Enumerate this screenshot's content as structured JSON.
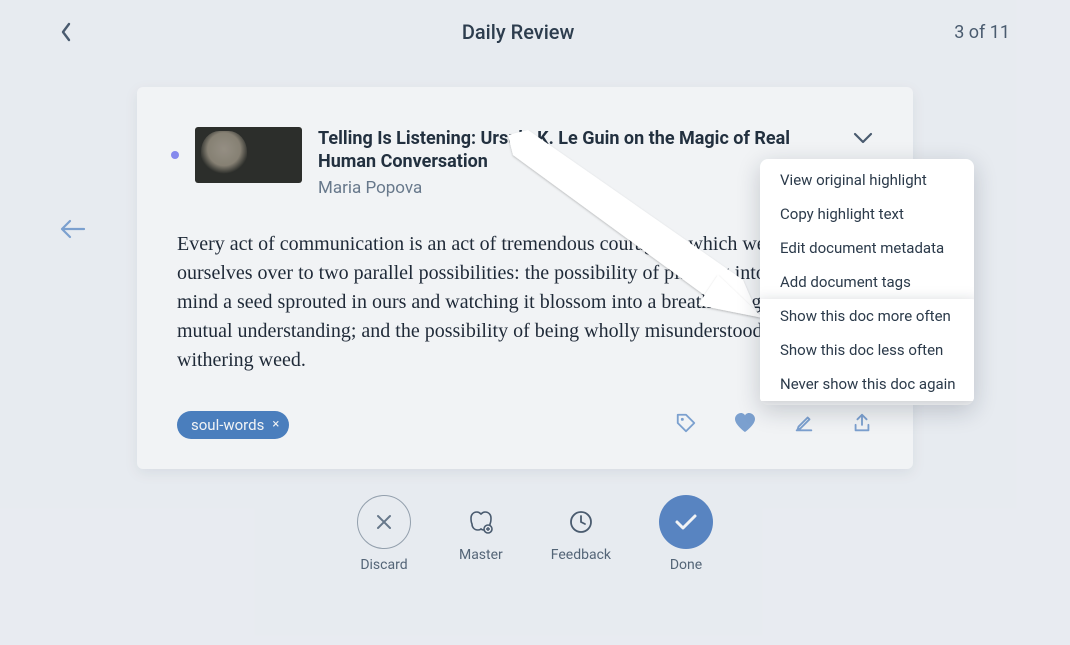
{
  "header": {
    "title": "Daily Review",
    "counter": "3 of 11"
  },
  "card": {
    "title": "Telling Is Listening: Ursula K. Le Guin on the Magic of Real Human Conversation",
    "author": "Maria Popova",
    "body": "Every act of communication is an act of tremendous courage in which we give ourselves over to two parallel possibilities: the possibility of planting into another mind a seed sprouted in ours and watching it blossom into a breathtaking flower of mutual understanding; and the possibility of being wholly misunderstood, reduced to a withering weed.",
    "tag": {
      "label": "soul-words",
      "remove": "×"
    }
  },
  "dropdown": {
    "items": [
      "View original highlight",
      "Copy highlight text",
      "Edit document metadata",
      "Add document tags",
      "Show this doc more often",
      "Show this doc less often",
      "Never show this doc again"
    ]
  },
  "actions": {
    "discard": "Discard",
    "master": "Master",
    "feedback": "Feedback",
    "done": "Done"
  },
  "colors": {
    "accent": "#5a87c7",
    "tag": "#4a80c3",
    "heart": "#7fa5d6"
  }
}
